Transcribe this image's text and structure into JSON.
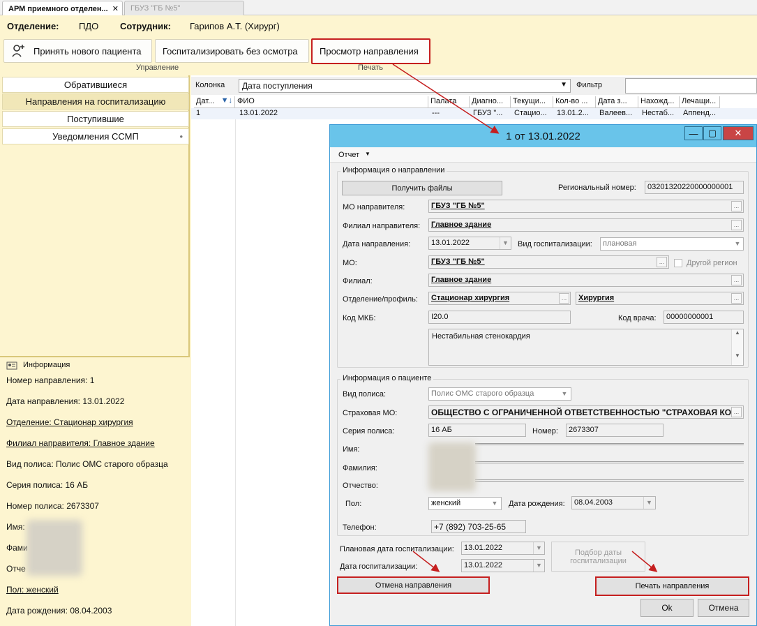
{
  "tabs": [
    {
      "label": "АРМ приемного отделен...",
      "active": true,
      "close": "✕"
    },
    {
      "label": "ГБУЗ \"ГБ №5\"",
      "active": false
    }
  ],
  "header": {
    "dept_label": "Отделение:",
    "dept_value": "ПДО",
    "staff_label": "Сотрудник:",
    "staff_value": "Гарипов А.Т. (Хирург)"
  },
  "toolbar": {
    "new_patient": "Принять нового пациента",
    "hospitalize": "Госпитализировать без осмотра",
    "view_referral": "Просмотр направления",
    "group_manage": "Управление",
    "group_print": "Печать"
  },
  "nav": {
    "items": [
      "Обратившиеся",
      "Направления на госпитализацию",
      "Поступившие",
      "Уведомления ССМП"
    ],
    "bullet": "•"
  },
  "info": {
    "title": "Информация",
    "lines": [
      "Номер направления: 1",
      "Дата направления: 13.01.2022",
      "Отделение: Стационар  хирургия",
      "Филиал направителя: Главное здание",
      "Вид полиса: Полис ОМС старого образца",
      "Серия полиса: 16 АБ",
      "Номер полиса: 2673307",
      "Имя:",
      "Фами",
      "Отче",
      "Пол: женский",
      "Дата рождения: 08.04.2003"
    ]
  },
  "grid": {
    "column_label": "Колонка",
    "column_value": "Дата поступления",
    "filter_label": "Фильтр",
    "headers": [
      "Дат...",
      "ФИО",
      "Палата",
      "Диагно...",
      "Текущи...",
      "Кол-во ...",
      "Дата з...",
      "Нахожд...",
      "Лечащи..."
    ],
    "row": [
      "1",
      "13.01.2022",
      "---",
      "ГБУЗ \"...",
      "Стацио...",
      "13.01.2...",
      "Валеев...",
      "Нестаб...",
      "Аппенд..."
    ]
  },
  "dialog": {
    "title": "1 от 13.01.2022",
    "menu": "Отчет",
    "sec1": "Информация о направлении",
    "get_files": "Получить файлы",
    "regional_label": "Региональный номер:",
    "regional_value": "03201320220000000001",
    "mo_sender_label": "МО направителя:",
    "mo_sender_value": "ГБУЗ \"ГБ №5\"",
    "branch_sender_label": "Филиал направителя:",
    "branch_sender_value": "Главное здание",
    "ref_date_label": "Дата направления:",
    "ref_date_value": "13.01.2022",
    "hosp_type_label": "Вид госпитализации:",
    "hosp_type_value": "плановая",
    "mo_label": "МО:",
    "mo_value": "ГБУЗ \"ГБ №5\"",
    "other_region": "Другой регион",
    "branch_label": "Филиал:",
    "branch_value": "Главное здание",
    "dept_label": "Отделение/профиль:",
    "dept_value": "Стационар  хирургия",
    "profile_value": "Хирургия",
    "mkb_label": "Код МКБ:",
    "mkb_value": "I20.0",
    "doctor_label": "Код врача:",
    "doctor_value": "00000000001",
    "diagnosis": "Нестабильная стенокардия",
    "sec2": "Информация о пациенте",
    "policy_type_label": "Вид полиса:",
    "policy_type_value": "Полис ОМС старого образца",
    "insurer_label": "Страховая МО:",
    "insurer_value": "ОБЩЕСТВО С ОГРАНИЧЕННОЙ ОТВЕТСТВЕННОСТЬЮ \"СТРАХОВАЯ КО",
    "series_label": "Серия полиса:",
    "series_value": "16 АБ",
    "number_label": "Номер:",
    "number_value": "2673307",
    "name_label": "Имя:",
    "surname_label": "Фамилия:",
    "patronymic_label": "Отчество:",
    "sex_label": "Пол:",
    "sex_value": "женский",
    "birth_label": "Дата рождения:",
    "birth_value": "08.04.2003",
    "phone_label": "Телефон:",
    "phone_value": "+7 (892) 703-25-65",
    "plan_date_label": "Плановая дата госпитализации:",
    "plan_date_value": "13.01.2022",
    "hosp_date_label": "Дата госпитализации:",
    "hosp_date_value": "13.01.2022",
    "pick_date": "Подбор даты госпитализации",
    "cancel_ref": "Отмена направления",
    "print_ref": "Печать направления",
    "ok": "Ok",
    "cancel": "Отмена"
  },
  "colors": {
    "accent_red": "#c51f1f",
    "title_blue": "#69c4ea",
    "panel_yellow": "#fdf5d0"
  }
}
